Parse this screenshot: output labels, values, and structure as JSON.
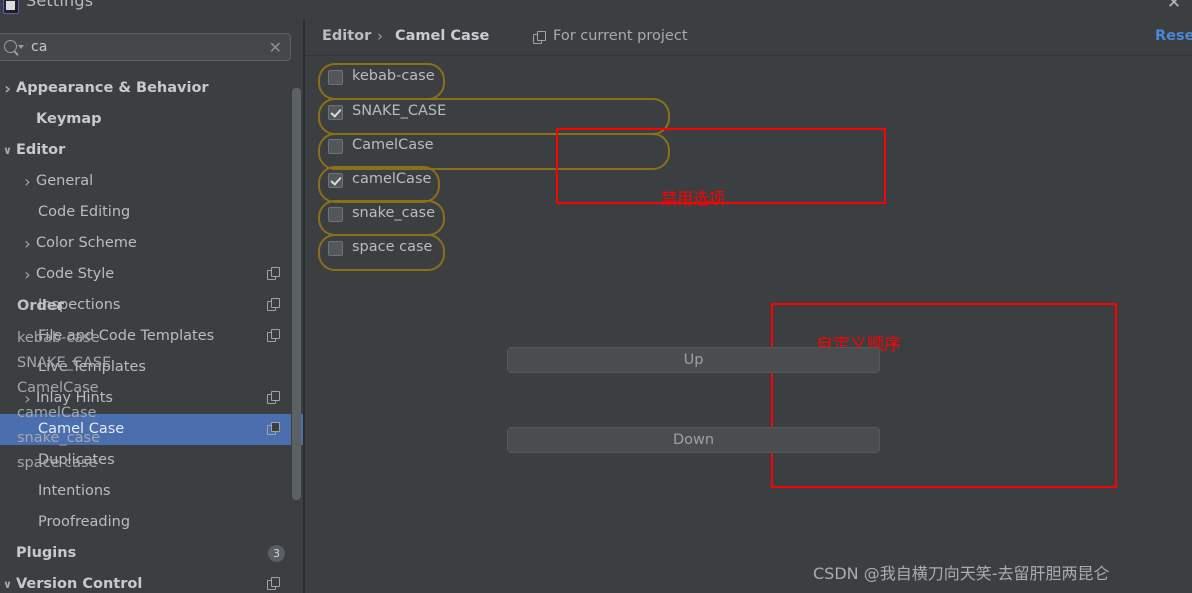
{
  "window": {
    "title": "Settings",
    "close_label": "✕",
    "app_icon": "intellij-logo-icon"
  },
  "search": {
    "value": "ca",
    "placeholder": "",
    "clear_label": "✕",
    "icon": "search-icon"
  },
  "sidebar": {
    "items": [
      {
        "label": "Appearance & Behavior",
        "arrow": "right",
        "indent": 16,
        "bold": true,
        "selected": false,
        "copy": false
      },
      {
        "label": "Keymap",
        "arrow": "none",
        "indent": 36,
        "bold": true,
        "selected": false,
        "copy": false
      },
      {
        "label": "Editor",
        "arrow": "down",
        "indent": 16,
        "bold": true,
        "selected": false,
        "copy": false
      },
      {
        "label": "General",
        "arrow": "right",
        "indent": 36,
        "bold": false,
        "selected": false,
        "copy": false
      },
      {
        "label": "Code Editing",
        "arrow": "none",
        "indent": 38,
        "bold": false,
        "selected": false,
        "copy": false
      },
      {
        "label": "Color Scheme",
        "arrow": "right",
        "indent": 36,
        "bold": false,
        "selected": false,
        "copy": false
      },
      {
        "label": "Code Style",
        "arrow": "right",
        "indent": 36,
        "bold": false,
        "selected": false,
        "copy": true
      },
      {
        "label": "Inspections",
        "arrow": "none",
        "indent": 38,
        "bold": false,
        "selected": false,
        "copy": true
      },
      {
        "label": "File and Code Templates",
        "arrow": "none",
        "indent": 38,
        "bold": false,
        "selected": false,
        "copy": true
      },
      {
        "label": "Live Templates",
        "arrow": "none",
        "indent": 38,
        "bold": false,
        "selected": false,
        "copy": false
      },
      {
        "label": "Inlay Hints",
        "arrow": "right",
        "indent": 36,
        "bold": false,
        "selected": false,
        "copy": true
      },
      {
        "label": "Camel Case",
        "arrow": "none",
        "indent": 38,
        "bold": false,
        "selected": true,
        "copy": true
      },
      {
        "label": "Duplicates",
        "arrow": "none",
        "indent": 38,
        "bold": false,
        "selected": false,
        "copy": false
      },
      {
        "label": "Intentions",
        "arrow": "none",
        "indent": 38,
        "bold": false,
        "selected": false,
        "copy": false
      },
      {
        "label": "Proofreading",
        "arrow": "none",
        "indent": 38,
        "bold": false,
        "selected": false,
        "copy": false
      },
      {
        "label": "Plugins",
        "arrow": "none",
        "indent": 16,
        "bold": true,
        "selected": false,
        "copy": false,
        "badge": "3"
      },
      {
        "label": "Version Control",
        "arrow": "down",
        "indent": 16,
        "bold": true,
        "selected": false,
        "copy": true
      }
    ]
  },
  "breadcrumb": {
    "root": "Editor",
    "separator": "›",
    "current": "Camel Case",
    "scope_label": "For current project",
    "scope_icon": "copy-scope-icon",
    "reset_label": "Reset"
  },
  "case_options": [
    {
      "label": "kebab-case",
      "checked": false
    },
    {
      "label": "SNAKE_CASE",
      "checked": true
    },
    {
      "label": "CamelCase",
      "checked": false
    },
    {
      "label": "camelCase",
      "checked": true
    },
    {
      "label": "snake_case",
      "checked": false
    },
    {
      "label": "space case",
      "checked": false
    }
  ],
  "order": {
    "title": "Order",
    "items": [
      "kebab-case",
      "SNAKE_CASE",
      "CamelCase",
      "camelCase",
      "snake_case",
      "space case"
    ],
    "up_label": "Up",
    "down_label": "Down"
  },
  "annotations": [
    {
      "text": "禁用选项",
      "note": "disable-options-annotation"
    },
    {
      "text": "自定义顺序",
      "note": "custom-order-annotation"
    }
  ],
  "watermark": "CSDN @我自横刀向天笑-去留肝胆两昆仑",
  "colors": {
    "accent_selection": "#4b6eaf",
    "highlight_pill": "#8a7019",
    "annotation_red": "#fe0000",
    "link_blue": "#4a88d6",
    "panel_bg": "#3c3f41"
  }
}
